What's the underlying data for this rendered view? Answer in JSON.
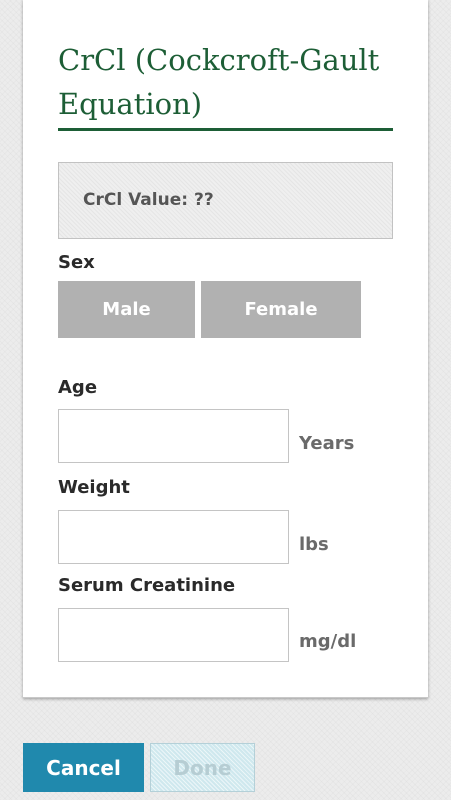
{
  "calculator": {
    "title": "CrCl (Cockcroft-Gault Equation)",
    "result_text": "CrCl Value: ??"
  },
  "sex": {
    "label": "Sex",
    "options": [
      "Male",
      "Female"
    ]
  },
  "fields": {
    "age": {
      "label": "Age",
      "unit": "Years",
      "value": ""
    },
    "weight": {
      "label": "Weight",
      "unit": "lbs",
      "value": ""
    },
    "creatinine": {
      "label": "Serum Creatinine",
      "unit": "mg/dl",
      "value": ""
    }
  },
  "footer": {
    "cancel_label": "Cancel",
    "done_label": "Done"
  },
  "colors": {
    "title_green": "#1d5e36",
    "cancel_blue": "#2089ad",
    "toggle_gray": "#b1b1b1"
  }
}
